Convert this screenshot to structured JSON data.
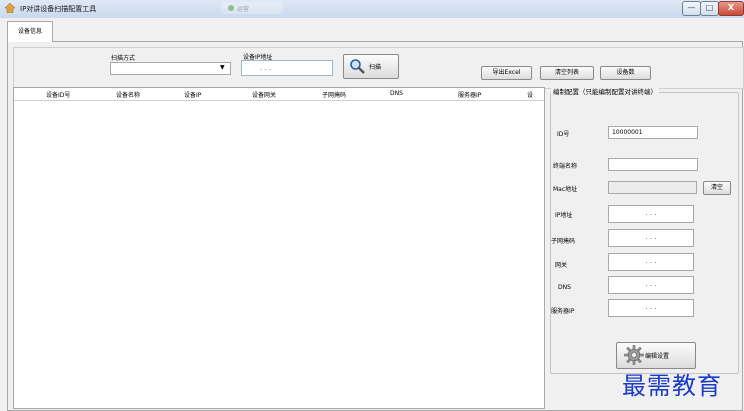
{
  "window": {
    "title": "IP对讲设备扫描配置工具",
    "background_tab_text": "运营",
    "minimize_glyph": "—",
    "maximize_glyph": "□",
    "close_glyph": "X"
  },
  "tabs": [
    {
      "label": "设备信息",
      "active": true
    }
  ],
  "toolbar": {
    "scan_mode_label": "扫描方式",
    "scan_mode_value": "",
    "device_ip_label": "设备IP地址",
    "device_ip_value": ". . .",
    "scan_button_label": "扫描",
    "export_excel_label": "导出Excel",
    "clear_list_label": "清空列表",
    "device_count_label": "设备数"
  },
  "table": {
    "columns": [
      "设备ID号",
      "设备名称",
      "设备IP",
      "设备网关",
      "子网掩码",
      "DNS",
      "服务器IP",
      "设"
    ],
    "rows": []
  },
  "config_panel": {
    "title": "编制配置（只能编制配置对讲终端）",
    "id_label": "ID号",
    "id_value": "10000001",
    "name_label": "终端名称",
    "name_value": "",
    "mac_label": "Mac地址",
    "mac_value": "",
    "mac_clear_label": "清空",
    "ip_label": "IP地址",
    "subnet_label": "子网掩码",
    "gateway_label": "网关",
    "dns_label": "DNS",
    "server_ip_label": "服务器IP",
    "ip_placeholder": ". . .",
    "set_button_label": "编辑设置"
  },
  "watermark": "最需教育",
  "colors": {
    "watermark": "#1a3ac8",
    "close_button": "#c8483a"
  },
  "icons": [
    "app-icon",
    "magnifier-icon",
    "gear-icon",
    "dropdown-arrow-icon"
  ]
}
